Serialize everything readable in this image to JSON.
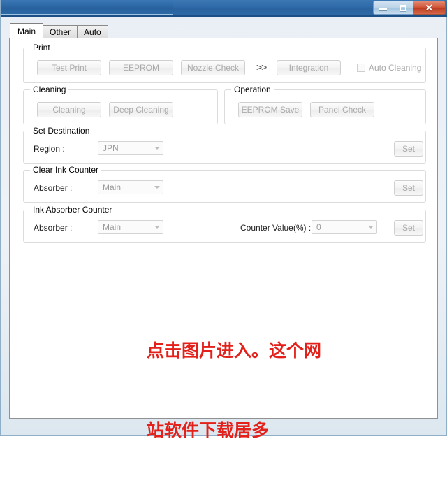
{
  "window": {
    "title": "",
    "caption_buttons": {
      "minimize": "minimize",
      "maximize": "maximize",
      "close": "✕"
    }
  },
  "tabs": [
    {
      "label": "Main",
      "active": true
    },
    {
      "label": "Other",
      "active": false
    },
    {
      "label": "Auto",
      "active": false
    }
  ],
  "groups": {
    "print": {
      "legend": "Print",
      "buttons": [
        {
          "label": "Test Print"
        },
        {
          "label": "EEPROM"
        },
        {
          "label": "Nozzle Check"
        },
        {
          "label": "Integration"
        }
      ],
      "separator": ">>",
      "checkbox": {
        "label": "Auto Cleaning",
        "checked": false
      }
    },
    "cleaning": {
      "legend": "Cleaning",
      "buttons": [
        {
          "label": "Cleaning"
        },
        {
          "label": "Deep Cleaning"
        }
      ]
    },
    "operation": {
      "legend": "Operation",
      "buttons": [
        {
          "label": "EEPROM Save"
        },
        {
          "label": "Panel Check"
        }
      ]
    },
    "set_destination": {
      "legend": "Set Destination",
      "region_label": "Region :",
      "region_value": "JPN",
      "set_label": "Set"
    },
    "clear_ink_counter": {
      "legend": "Clear Ink Counter",
      "absorber_label": "Absorber :",
      "absorber_value": "Main",
      "set_label": "Set"
    },
    "ink_absorber_counter": {
      "legend": "Ink Absorber Counter",
      "absorber_label": "Absorber :",
      "absorber_value": "Main",
      "counter_label": "Counter Value(%) :",
      "counter_value": "0",
      "set_label": "Set"
    }
  },
  "watermark": {
    "line1": "点击图片进入。这个网",
    "line2": "站软件下载居多",
    "color": "#e3211a"
  },
  "colors": {
    "titlebar_blue": "#2f6aa8",
    "close_red": "#c94527",
    "window_bg": "#eef2f6",
    "page_bg": "#ffffff",
    "group_border": "#dcdcdc",
    "disabled_text": "#aaaaaa"
  }
}
